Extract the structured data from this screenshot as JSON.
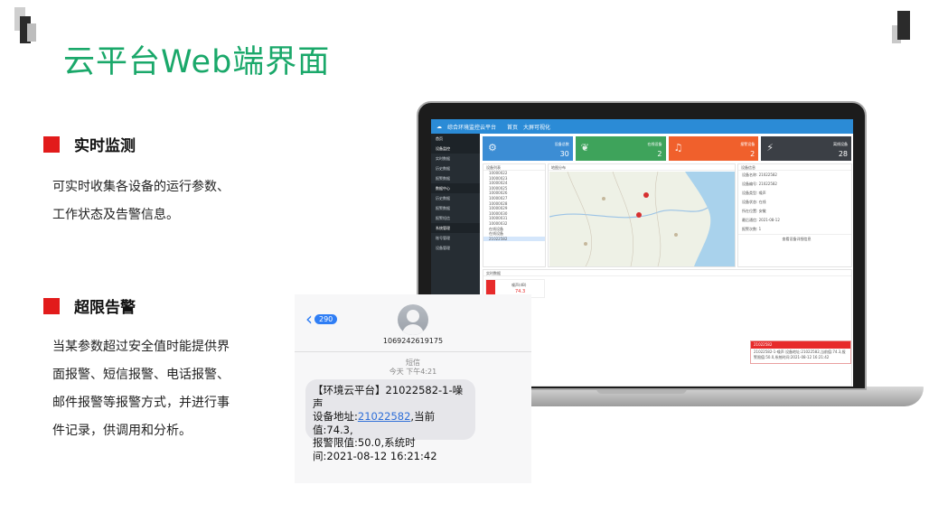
{
  "title": "云平台Web端界面",
  "sections": [
    {
      "heading": "实时监测",
      "lines": [
        "可实时收集各设备的运行参数、",
        "工作状态及告警信息。"
      ]
    },
    {
      "heading": "超限告警",
      "lines": [
        "当某参数超过安全值时能提供界",
        "面报警、短信报警、电话报警、",
        "邮件报警等报警方式，并进行事",
        "件记录，供调用和分析。"
      ]
    }
  ],
  "colors": {
    "title": "#1aa86a",
    "marker": "#e21b1b",
    "card1": "#3c8dd4",
    "card2": "#3ea35b",
    "card3": "#f0602c",
    "card4": "#3b3f45"
  },
  "dashboard": {
    "brand": "综合环境监控云平台",
    "nav_home": "首页",
    "nav_screen": "大屏可视化",
    "sidebar": [
      "首页",
      "设备监控",
      "实时数据",
      "历史数据",
      "报警数据",
      "数据中心",
      "历史数据",
      "报警数据",
      "报警短信",
      "系统管理",
      "账号管理",
      "设备管理"
    ],
    "cards": [
      {
        "label": "设备总数",
        "value": "30",
        "icon": "gear-icon"
      },
      {
        "label": "在线设备",
        "value": "2",
        "icon": "leaf-icon"
      },
      {
        "label": "报警设备",
        "value": "2",
        "icon": "bell-icon"
      },
      {
        "label": "离线设备",
        "value": "28",
        "icon": "plug-icon"
      }
    ],
    "device_panel_title": "设备列表",
    "devices": [
      "10000022",
      "10000023",
      "10000024",
      "10000025",
      "10000026",
      "10000027",
      "10000028",
      "10000029",
      "10000030",
      "10000031",
      "10000032",
      "在线设备",
      "在线设备",
      "21022582"
    ],
    "map_title": "地图分布",
    "info_title": "设备信息",
    "info_rows": [
      "设备名称: 21022582",
      "设备编号: 21022582",
      "设备类型: 噪声",
      "设备状态: 在线",
      "所在位置: 安徽",
      "最后通信: 2021-08-12",
      "报警次数: 1"
    ],
    "info_button": "查看设备详细信息",
    "realtime_title": "实时数据",
    "noise_label": "噪声(dB)",
    "noise_value": "74.3"
  },
  "alert": {
    "id": "21022582",
    "text": "21022582-1-噪声 设备地址:21022582,当前值:74.3,报警限值:50.0,系统时间:2021-08-12 16:21:42"
  },
  "sms": {
    "back_count": "290",
    "sender": "1069242619175",
    "type": "短信",
    "time": "今天 下午4:21",
    "line1": "【环境云平台】21022582-1-噪声",
    "line2_prefix": "设备地址:",
    "line2_link": "21022582",
    "line2_suffix": ",当前值:74.3,",
    "line3": "报警限值:50.0,系统时",
    "line4": "间:2021-08-12 16:21:42"
  }
}
